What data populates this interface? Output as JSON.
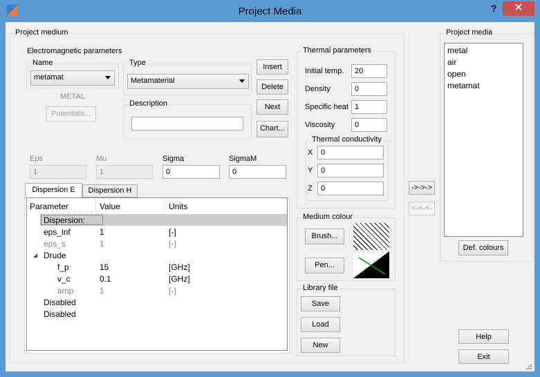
{
  "window": {
    "title": "Project Media",
    "help_glyph": "?",
    "close_glyph": "✕"
  },
  "medium": {
    "group_label": "Project medium",
    "em": {
      "group_label": "Electromagnetic parameters",
      "name_label": "Name",
      "name_value": "metamat",
      "type_label": "Type",
      "type_value": "Metamaterial",
      "base_label": "METAL",
      "potentials_label": "Potentials...",
      "description_label": "Description",
      "description_value": ""
    },
    "buttons": {
      "insert": "Insert",
      "delete": "Delete",
      "next": "Next",
      "chart": "Chart..."
    },
    "params": {
      "eps_label": "Eps",
      "eps_value": "1",
      "mu_label": "Mu",
      "mu_value": "1",
      "sigma_label": "Sigma",
      "sigma_value": "0",
      "sigmam_label": "SigmaM",
      "sigmam_value": "0"
    },
    "tabs": [
      "Dispersion E",
      "Dispersion H"
    ],
    "table": {
      "headers": [
        "Parameter",
        "Value",
        "Units"
      ],
      "rows": [
        {
          "param": "Dispersion:",
          "value": "",
          "units": ""
        },
        {
          "param": "eps_inf",
          "value": "1",
          "units": "[-]"
        },
        {
          "param": "eps_s",
          "value": "1",
          "units": "[-]"
        },
        {
          "param": "Drude",
          "value": "",
          "units": ""
        },
        {
          "param": "f_p",
          "value": "15",
          "units": "[GHz]"
        },
        {
          "param": "v_c",
          "value": "0.1",
          "units": "[GHz]"
        },
        {
          "param": "amp",
          "value": "1",
          "units": "[-]"
        },
        {
          "param": "Disabled",
          "value": "",
          "units": ""
        },
        {
          "param": "Disabled",
          "value": "",
          "units": ""
        }
      ]
    },
    "thermal": {
      "group_label": "Thermal parameters",
      "initial_temp_label": "Initial temp.",
      "initial_temp_value": "20",
      "density_label": "Density",
      "density_value": "0",
      "specific_heat_label": "Specific heat",
      "specific_heat_value": "1",
      "viscosity_label": "Viscosity",
      "viscosity_value": "0",
      "conductivity": {
        "group_label": "Thermal conductivity",
        "x_label": "X",
        "x_value": "0",
        "y_label": "Y",
        "y_value": "0",
        "z_label": "Z",
        "z_value": "0"
      }
    },
    "colour": {
      "group_label": "Medium colour",
      "brush_label": "Brush...",
      "pen_label": "Pen..."
    },
    "library": {
      "group_label": "Library file",
      "save_label": "Save",
      "load_label": "Load",
      "new_label": "New"
    }
  },
  "transfer": {
    "add_label": "->->->",
    "remove_label": "<-<-<-"
  },
  "project_media": {
    "group_label": "Project media",
    "items": [
      "metal",
      "air",
      "open",
      "metamat"
    ],
    "def_colours_label": "Def. colours"
  },
  "footer": {
    "help_label": "Help",
    "exit_label": "Exit"
  }
}
